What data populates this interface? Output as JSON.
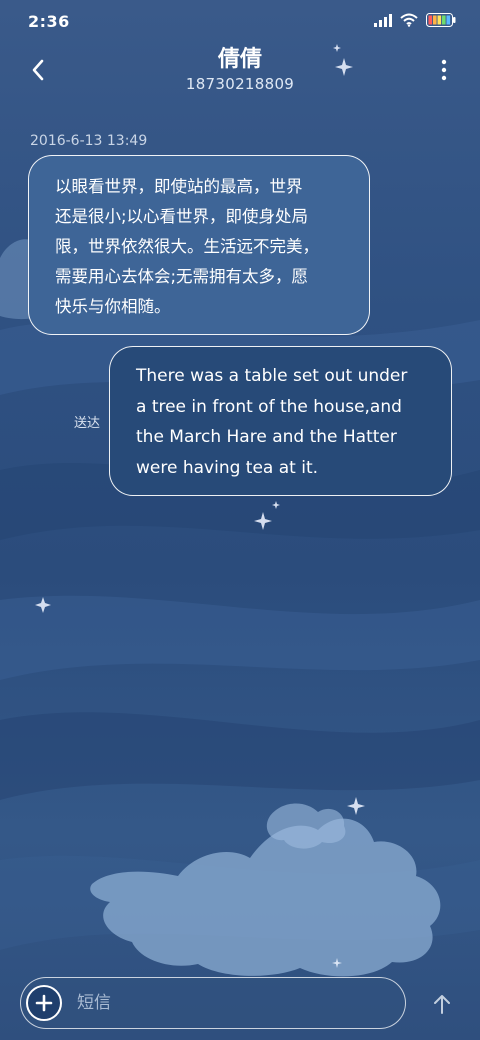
{
  "status_bar": {
    "time": "2:36",
    "icons": [
      "signal-icon",
      "wifi-icon",
      "battery-icon"
    ]
  },
  "header": {
    "contact_name": "倩倩",
    "contact_number": "18730218809",
    "back_icon": "chevron-left-icon",
    "more_icon": "more-vertical-icon"
  },
  "conversation": {
    "timestamp": "2016-6-13 13:49",
    "messages": [
      {
        "direction": "incoming",
        "lines": [
          "以眼看世界，即使站的最高，世界",
          "还是很小;以心看世界，即使身处局",
          "限，世界依然很大。生活远不完美，",
          "需要用心去体会;无需拥有太多，愿",
          "快乐与你相随。"
        ]
      },
      {
        "direction": "outgoing",
        "lines": [
          "There was a table set out under",
          "a tree in front of the house,and",
          "the March Hare and the Hatter",
          "were having tea at it."
        ],
        "status": "送达"
      }
    ]
  },
  "composer": {
    "add_icon": "plus-icon",
    "placeholder": "短信",
    "value": "",
    "send_icon": "arrow-up-icon"
  },
  "colors": {
    "background": "#2d4d7c",
    "incoming_bubble": "#3e6597",
    "outgoing_bubble": "#274a78",
    "bubble_border": "#ffffff"
  }
}
